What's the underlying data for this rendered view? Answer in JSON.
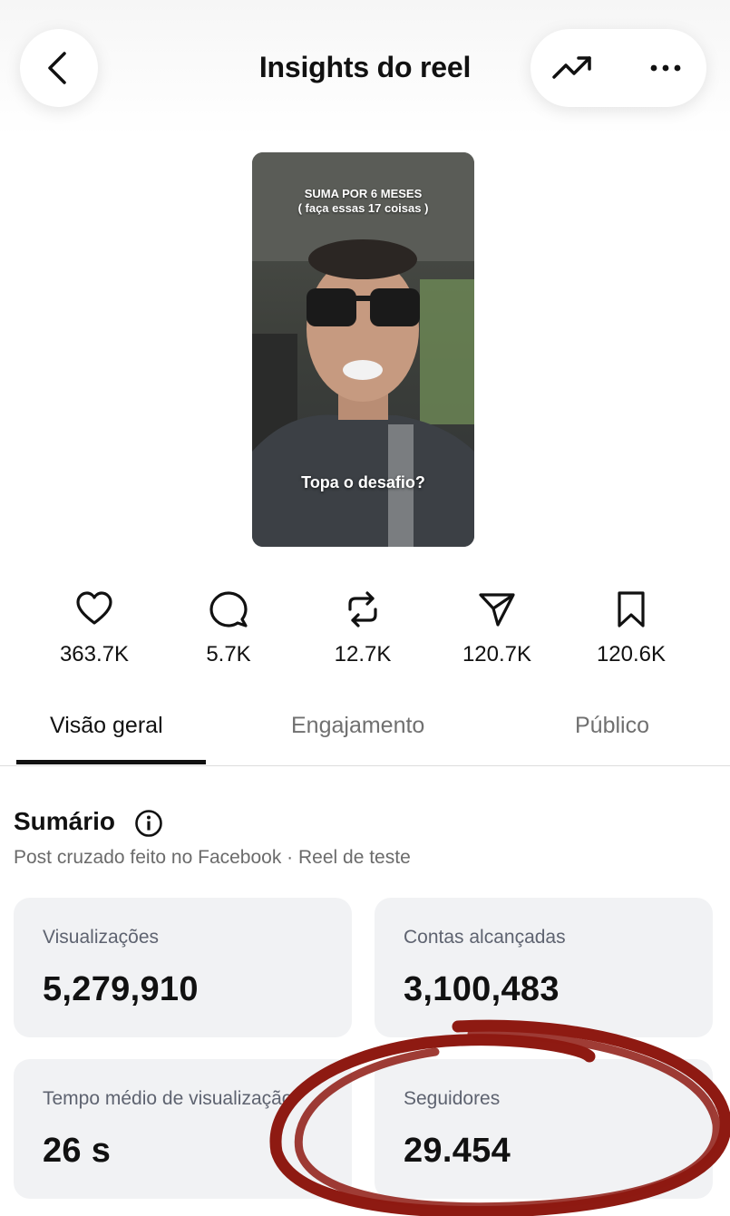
{
  "header": {
    "title": "Insights do reel",
    "icons": {
      "back": "chevron-left-icon",
      "trend": "trending-up-icon",
      "more": "more-horizontal-icon"
    }
  },
  "reel": {
    "overlay_top_line1": "SUMA POR 6 MESES",
    "overlay_top_line2": "( faça essas 17 coisas )",
    "overlay_bottom": "Topa o desafio?"
  },
  "stats": [
    {
      "icon": "heart-icon",
      "value": "363.7K"
    },
    {
      "icon": "comment-icon",
      "value": "5.7K"
    },
    {
      "icon": "repost-icon",
      "value": "12.7K"
    },
    {
      "icon": "send-icon",
      "value": "120.7K"
    },
    {
      "icon": "bookmark-icon",
      "value": "120.6K"
    }
  ],
  "tabs": [
    {
      "label": "Visão geral",
      "active": true
    },
    {
      "label": "Engajamento",
      "active": false
    },
    {
      "label": "Público",
      "active": false
    }
  ],
  "summary": {
    "title": "Sumário",
    "subtitle": "Post cruzado feito no Facebook · Reel de teste"
  },
  "cards": [
    {
      "label": "Visualizações",
      "value": "5,279,910"
    },
    {
      "label": "Contas alcançadas",
      "value": "3,100,483"
    },
    {
      "label": "Tempo médio de visualização",
      "value": "26 s"
    },
    {
      "label": "Seguidores",
      "value": "29.454"
    }
  ],
  "colors": {
    "annotation_red": "#8e1a12",
    "card_bg": "#f1f2f4",
    "text": "#111111",
    "muted": "#6b6b6b"
  }
}
